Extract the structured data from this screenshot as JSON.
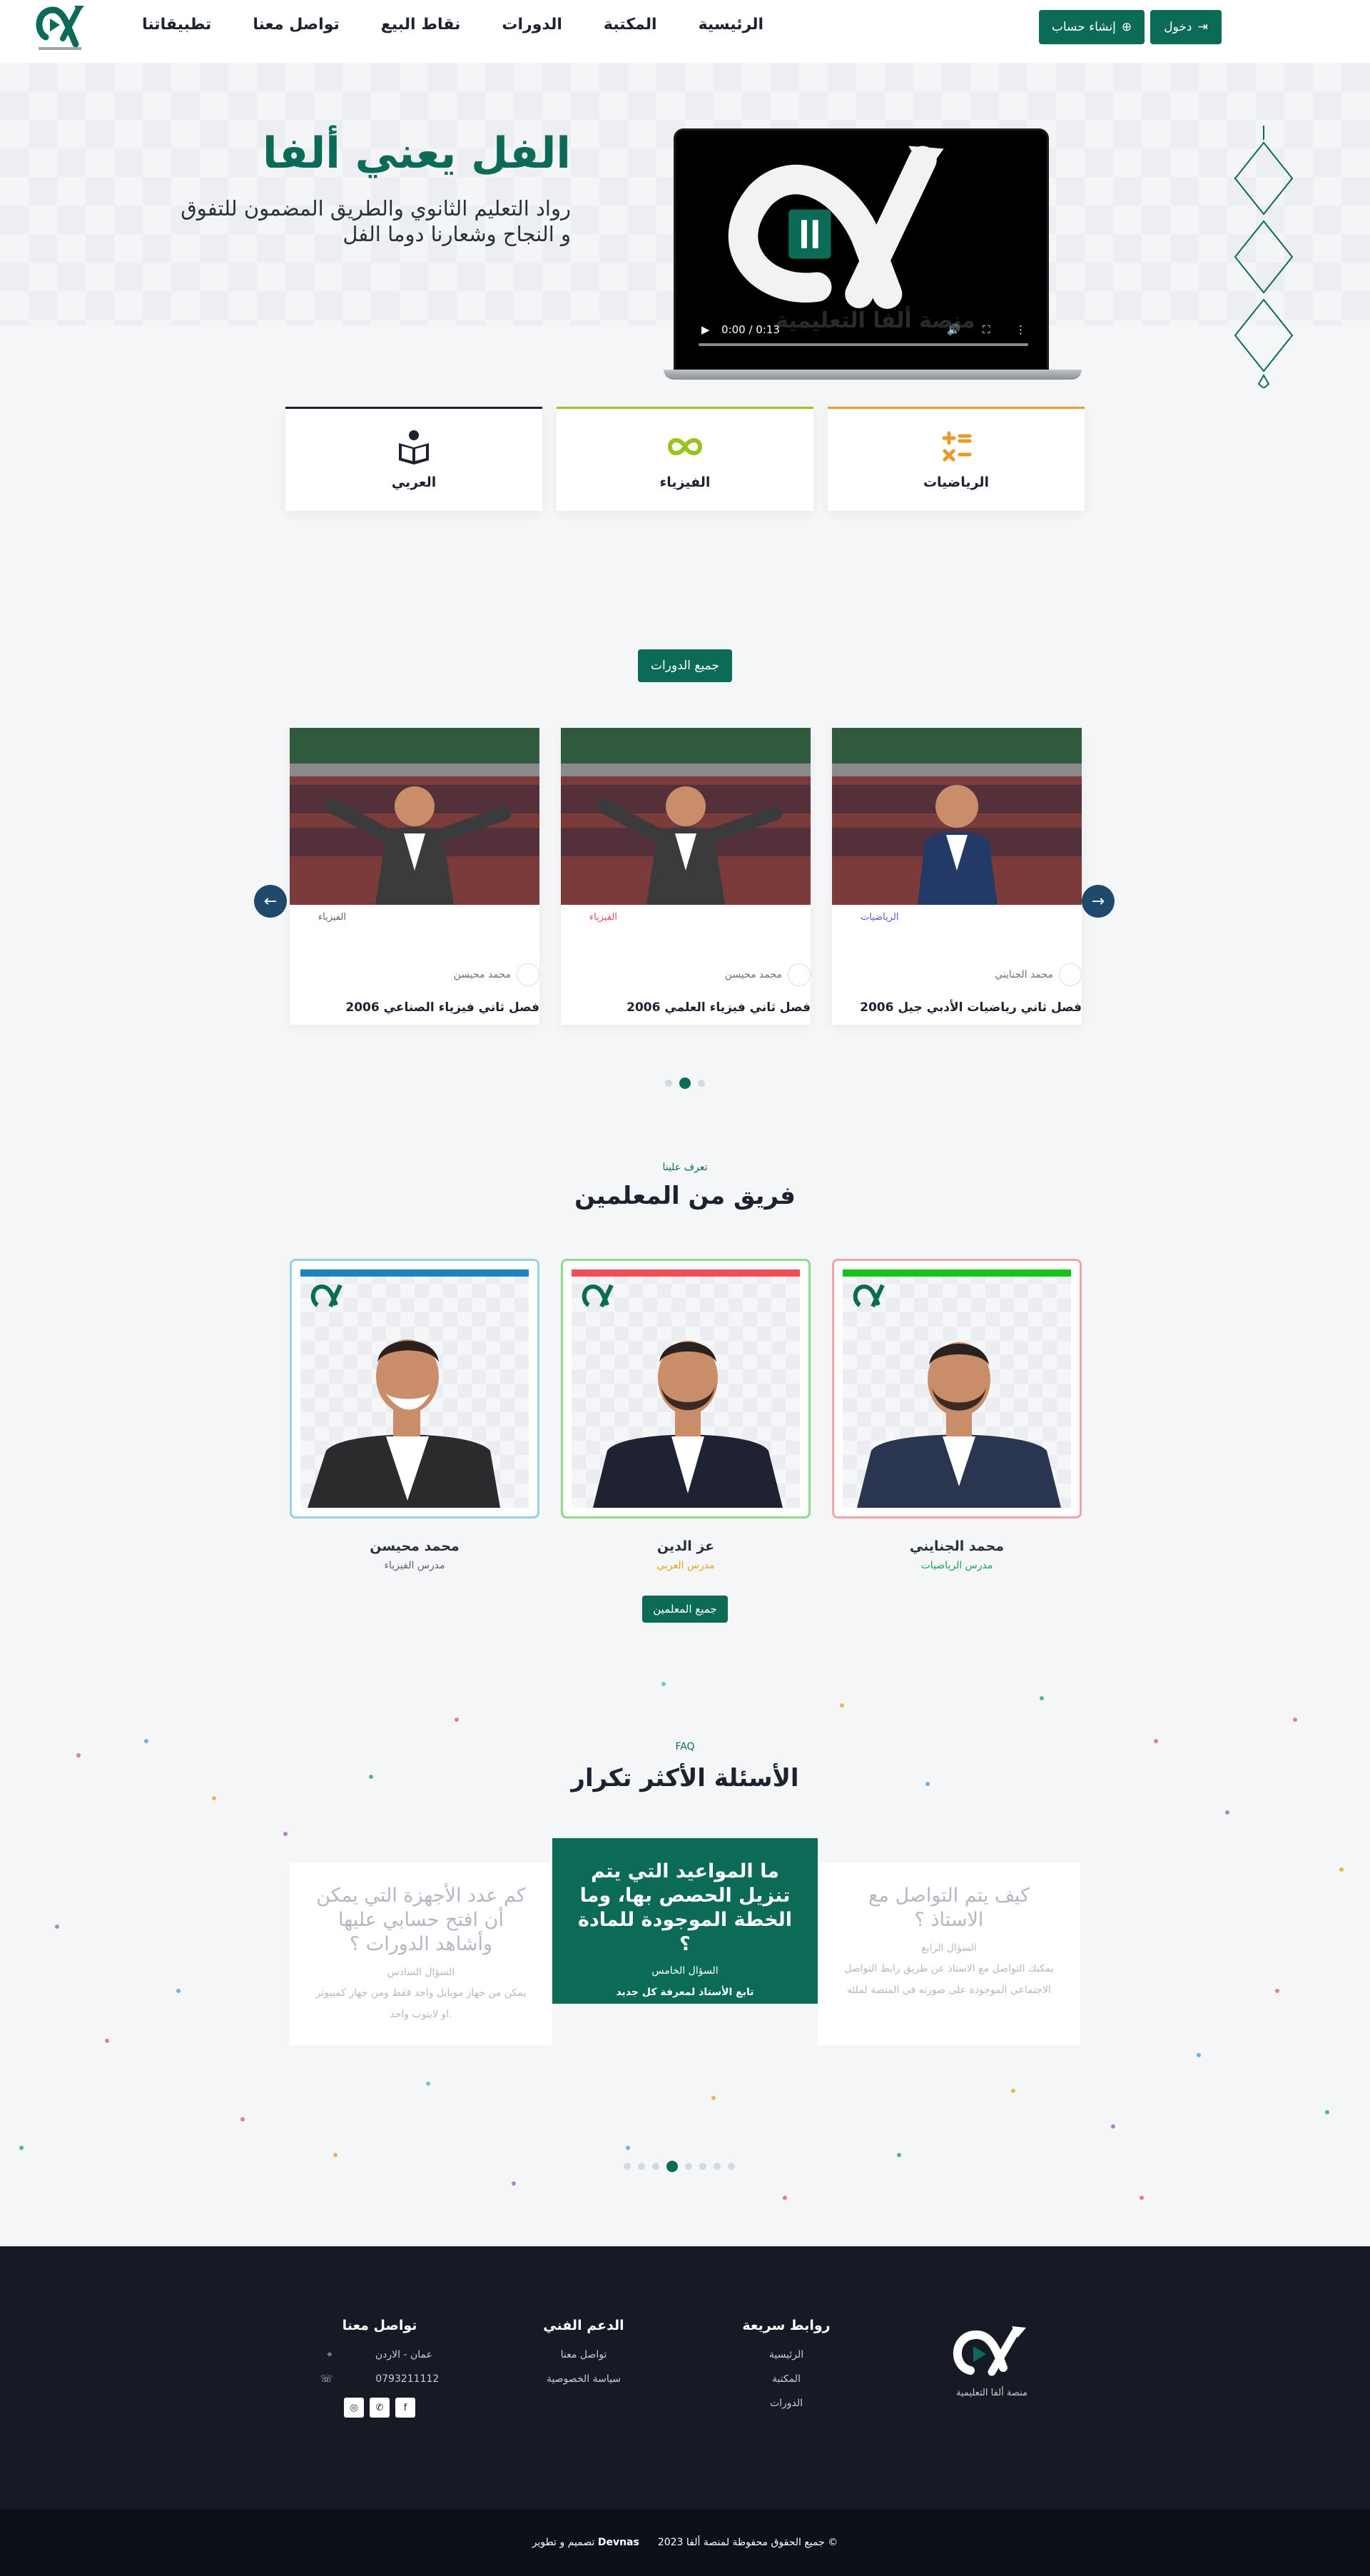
{
  "nav": {
    "links": [
      "الرئيسية",
      "المكتبة",
      "الدورات",
      "نقاط البيع",
      "تواصل معنا",
      "تطبيقاتنا"
    ],
    "login_label": "دخول",
    "register_label": "إنشاء حساب"
  },
  "hero": {
    "title": "الفل يعني ألفا",
    "subtitle": "رواد التعليم الثانوي والطريق المضمون للتفوق و النجاح وشعارنا دوما الفل",
    "video_time": "0:00 / 0:13",
    "video_watermark": "منصة ألفا التعليمية"
  },
  "subjects": [
    {
      "label": "الرياضيات",
      "icon": "math-icon",
      "color": "#e99a2c"
    },
    {
      "label": "الفيزياء",
      "icon": "infinity-icon",
      "color": "#9cc21f"
    },
    {
      "label": "العربي",
      "icon": "book-reader-icon",
      "color": "#1d2230"
    }
  ],
  "courses": {
    "all_label": "جميع الدورات",
    "items": [
      {
        "tag": "الرياضيات",
        "tag_color": "#4a5ad1",
        "teacher": "محمد الجنايني",
        "title": "فصل ثاني رياضيات الأدبي جيل 2006"
      },
      {
        "tag": "الفيزياء",
        "tag_color": "#e04a5a",
        "teacher": "محمد محيسن",
        "title": "فصل ثاني فيزياء العلمي 2006"
      },
      {
        "tag": "الفيزياء",
        "tag_color": "#5c5f6b",
        "teacher": "محمد محيسن",
        "title": "فصل ثاني فيزياء الصناعي 2006"
      }
    ]
  },
  "team": {
    "kicker": "تعرف علينا",
    "title": "فريق من المعلمين",
    "all_label": "جميع المعلمين",
    "members": [
      {
        "name": "محمد الجنايني",
        "role": "مدرس الرياضيات",
        "role_color": "#1aa65a",
        "stripe": "#17c21b",
        "border": "#f2a3a8"
      },
      {
        "name": "عز الدين",
        "role": "مدرس العربي",
        "role_color": "#e9a11c",
        "stripe": "#ef4e56",
        "border": "#8ddc8a"
      },
      {
        "name": "محمد محيسن",
        "role": "مدرس الفيزياء",
        "role_color": "#5c5f6b",
        "stripe": "#1b84be",
        "border": "#95d3e2"
      }
    ]
  },
  "faq": {
    "kicker": "FAQ",
    "title": "الأسئلة الأكثر تكرار",
    "left": {
      "q": "كم عدد الأجهزة التي يمكن أن افتح حسابي عليها وأشاهد الدورات ؟",
      "num": "السؤال السادس",
      "a": "يمكن من جهاز موبايل واحد فقط ومن جهاز كمبيوتر او لابتوب واحد."
    },
    "active": {
      "q": "ما المواعيد التي يتم تنزيل الحصص بها، وما الخطة الموجودة للمادة ؟",
      "num": "السؤال الخامس",
      "a": "تابع الأستاذ لمعرفة كل جديد"
    },
    "right": {
      "q": "كيف يتم التواصل مع الاستاذ ؟",
      "num": "السؤال الرابع",
      "a": "يمكنك التواصل مع الاستاذ عن طريق رابط التواصل الاجتماعي الموجودة على صورته في المنصة لملئه"
    }
  },
  "footer": {
    "logo_caption": "منصة ألفا التعليمية",
    "quick_links_title": "روابط سريعة",
    "quick_links": [
      "الرئيسية",
      "المكتبة",
      "الدورات"
    ],
    "support_title": "الدعم الفني",
    "support_links": [
      "تواصل معنا",
      "سياسة الخصوصية"
    ],
    "contact_title": "تواصل معنا",
    "contact_location": "عمان - الاردن",
    "contact_phone": "0793211112",
    "copyright": "جميع الحقوق محفوظة لمنصة ألفا 2023 ©",
    "credit_prefix": "تصميم و تطوير",
    "credit_name": "Devnas"
  },
  "colors": {
    "primary": "#0c6b57",
    "footer": "#171a24",
    "arrow": "#1f4a6e"
  }
}
